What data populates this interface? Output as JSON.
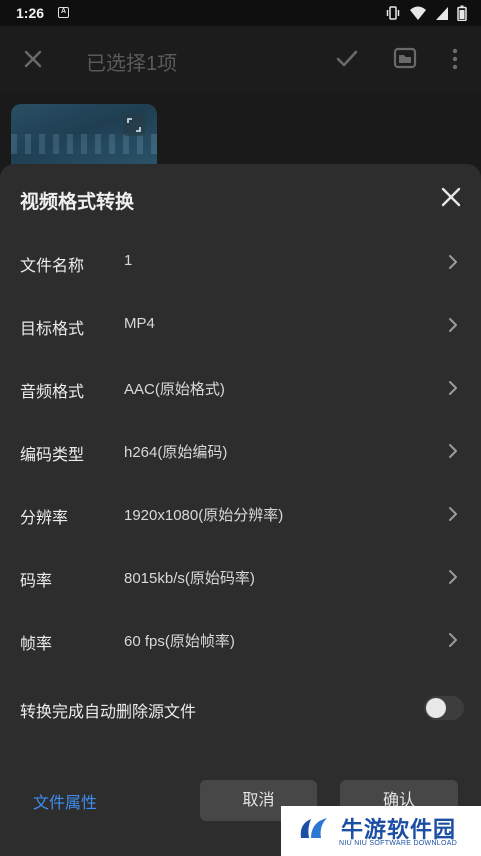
{
  "status_bar": {
    "time": "1:26",
    "notification_icon": "A",
    "icons": [
      "vibrate-icon",
      "wifi-icon",
      "signal-icon",
      "battery-icon"
    ]
  },
  "header": {
    "title": "已选择1项",
    "icons": [
      "close-icon",
      "check-icon",
      "folder-icon",
      "more-icon"
    ]
  },
  "dialog": {
    "title": "视频格式转换",
    "rows": [
      {
        "label": "文件名称",
        "value": "1"
      },
      {
        "label": "目标格式",
        "value": "MP4"
      },
      {
        "label": "音频格式",
        "value": "AAC(原始格式)"
      },
      {
        "label": "编码类型",
        "value": "h264(原始编码)"
      },
      {
        "label": "分辨率",
        "value": "1920x1080(原始分辨率)"
      },
      {
        "label": "码率",
        "value": "8015kb/s(原始码率)"
      },
      {
        "label": "帧率",
        "value": "60 fps(原始帧率)"
      }
    ],
    "auto_delete": {
      "label": "转换完成自动删除源文件",
      "enabled": false
    },
    "properties_link": "文件属性",
    "cancel_label": "取消",
    "confirm_label": "确认"
  },
  "watermark": {
    "name": "牛游软件园",
    "subtitle": "NIU NIU SOFTWARE DOWNLOAD"
  },
  "colors": {
    "sheet_bg": "#2d2d2d",
    "link": "#3d8ef0",
    "button_bg": "#474747"
  }
}
